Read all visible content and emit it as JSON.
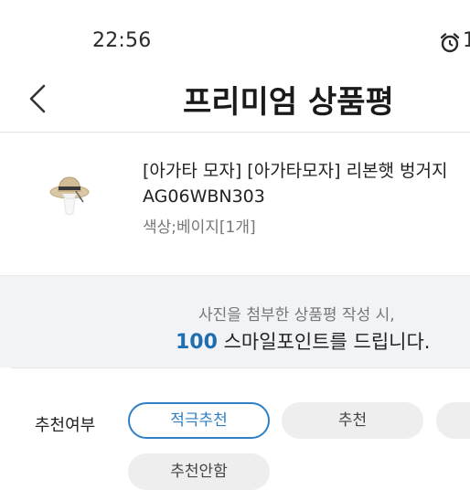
{
  "status_bar": {
    "time": "22:56",
    "right_icon": "alarm-icon",
    "cut_text": "1"
  },
  "header": {
    "back_icon": "chevron-left-icon",
    "title": "프리미엄 상품평"
  },
  "product": {
    "name": "[아가타 모자]  [아가타모자] 리본햇 벙거지",
    "code": "AG06WBN303",
    "option": "색상;베이지[1개]"
  },
  "notice": {
    "line1": "사진을 첨부한 상품평 작성 시,",
    "points": "100",
    "line2_suffix": " 스마일포인트를 드립니다."
  },
  "recommend": {
    "label": "추천여부",
    "options": [
      "적극추천",
      "추천",
      "",
      "추천안함"
    ],
    "selected": "적극추천",
    "accent_color": "#2f7fc4"
  }
}
